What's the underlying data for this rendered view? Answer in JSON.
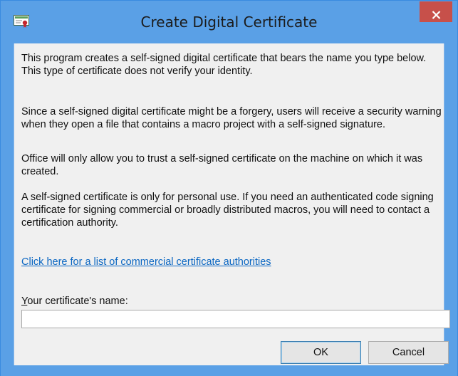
{
  "window": {
    "title": "Create Digital Certificate",
    "frame_color": "#5aa0e6",
    "close_button_color": "#c7504a"
  },
  "icons": {
    "app": "certificate-icon",
    "close": "close-icon"
  },
  "paragraphs": [
    "This program creates a self-signed digital certificate that bears the name you type below. This type of certificate does not verify your identity.",
    "Since a self-signed digital certificate might be a forgery, users will receive a security warning when they open a file that contains a macro project with a self-signed signature.",
    "Office will only allow you to trust a self-signed certificate on the machine on which it was created.",
    "A self-signed certificate is only for personal use. If you need an authenticated code signing certificate for signing commercial or broadly distributed macros, you will need to contact a certification authority."
  ],
  "link": {
    "text": "Click here for a list of commercial certificate authorities",
    "color": "#0a66c2"
  },
  "name_field": {
    "label_accel": "Y",
    "label_rest": "our certificate's name:",
    "value": "",
    "placeholder": ""
  },
  "buttons": {
    "ok_label": "OK",
    "cancel_label": "Cancel"
  }
}
